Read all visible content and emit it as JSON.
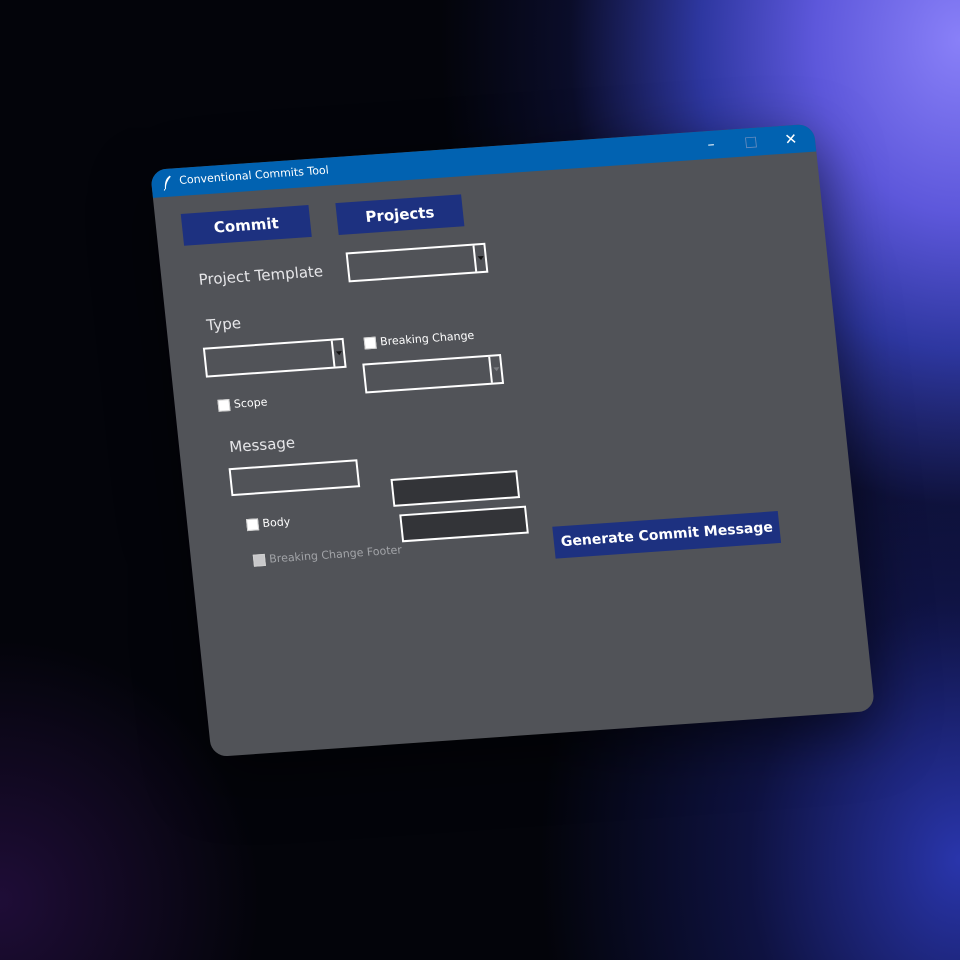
{
  "window": {
    "title": "Conventional Commits Tool",
    "controls": {
      "minimize": "–",
      "maximize": "□",
      "close": "✕"
    }
  },
  "tabs": {
    "commit": "Commit",
    "projects": "Projects"
  },
  "form": {
    "project_template_label": "Project Template",
    "project_template_value": "",
    "type_label": "Type",
    "type_value": "",
    "breaking_change_label": "Breaking Change",
    "breaking_change_checked": false,
    "scope_label": "Scope",
    "scope_checked": false,
    "message_label": "Message",
    "message_value": "",
    "body_label": "Body",
    "body_checked": false,
    "breaking_change_footer_label": "Breaking Change Footer",
    "breaking_change_footer_enabled": false
  },
  "actions": {
    "generate": "Generate Commit Message"
  },
  "colors": {
    "titlebar": "#0162b1",
    "window_bg": "#515358",
    "button_bg": "#1d3180"
  },
  "icons": {
    "app": "feather-icon"
  }
}
